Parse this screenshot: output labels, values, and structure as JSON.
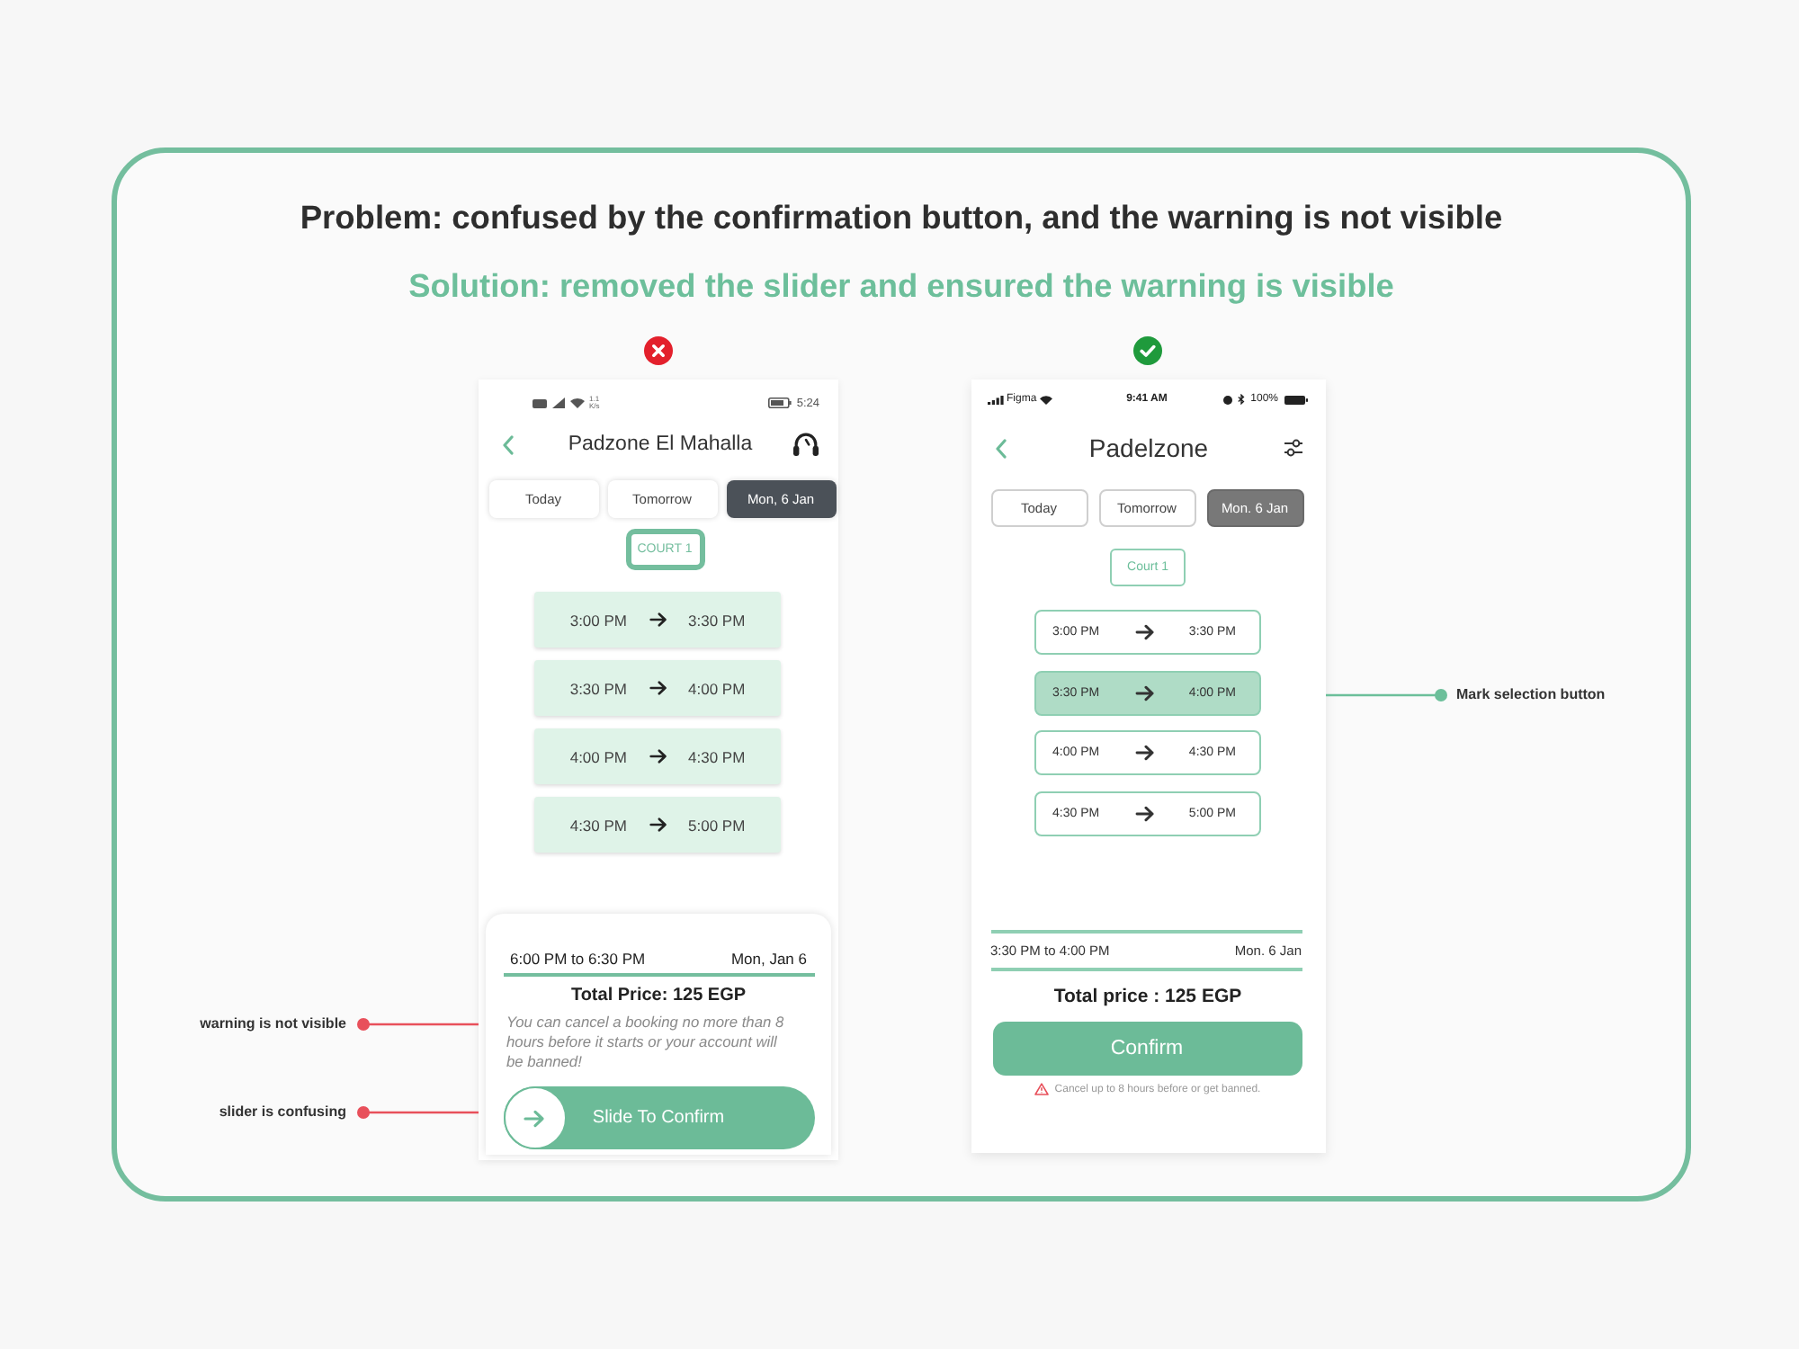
{
  "problem": "Problem: confused by the confirmation button, and the warning is not visible",
  "solution": "Solution: removed the slider and ensured the warning is visible",
  "before": {
    "approved": false,
    "status_bar": {
      "net_speed": "1.1 K/s",
      "time": "5:24"
    },
    "title": "Padzone El Mahalla",
    "tabs": [
      {
        "label": "Today",
        "selected": false
      },
      {
        "label": "Tomorrow",
        "selected": false
      },
      {
        "label": "Mon, 6 Jan",
        "selected": true
      }
    ],
    "court": "COURT 1",
    "slots": [
      {
        "start": "3:00 PM",
        "end": "3:30 PM",
        "selected": false
      },
      {
        "start": "3:30 PM",
        "end": "4:00 PM",
        "selected": false
      },
      {
        "start": "4:00 PM",
        "end": "4:30 PM",
        "selected": false
      },
      {
        "start": "4:30 PM",
        "end": "5:00 PM",
        "selected": false
      }
    ],
    "summary": {
      "time_range": "6:00 PM to 6:30 PM",
      "date": "Mon, Jan 6",
      "total": "Total Price: 125 EGP",
      "warning": "You can cancel a booking no more than 8 hours before it starts or your account will be banned!"
    },
    "slider": {
      "label": "Slide To Confirm",
      "level": 0
    },
    "annotations": [
      {
        "kind": "warning",
        "label": "warning is not visible"
      },
      {
        "kind": "slider",
        "label": "slider is confusing"
      }
    ]
  },
  "after": {
    "approved": true,
    "status_bar": {
      "carrier": "Figma",
      "time": "9:41 AM",
      "battery": "100%"
    },
    "title": "Padelzone",
    "tabs": [
      {
        "label": "Today",
        "selected": false
      },
      {
        "label": "Tomorrow",
        "selected": false
      },
      {
        "label": "Mon. 6 Jan",
        "selected": true
      }
    ],
    "court": "Court 1",
    "slots": [
      {
        "start": "3:00 PM",
        "end": "3:30 PM",
        "selected": false
      },
      {
        "start": "3:30 PM",
        "end": "4:00 PM",
        "selected": true
      },
      {
        "start": "4:00 PM",
        "end": "4:30 PM",
        "selected": false
      },
      {
        "start": "4:30 PM",
        "end": "5:00 PM",
        "selected": false
      }
    ],
    "summary": {
      "time_range": "3:30 PM to 4:00 PM",
      "date": "Mon. 6 Jan",
      "total": "Total price : 125 EGP"
    },
    "confirm_button": "Confirm",
    "warning": "Cancel up to 8 hours before or get banned.",
    "annotations": [
      {
        "kind": "selection",
        "label": "Mark selection button"
      }
    ]
  }
}
